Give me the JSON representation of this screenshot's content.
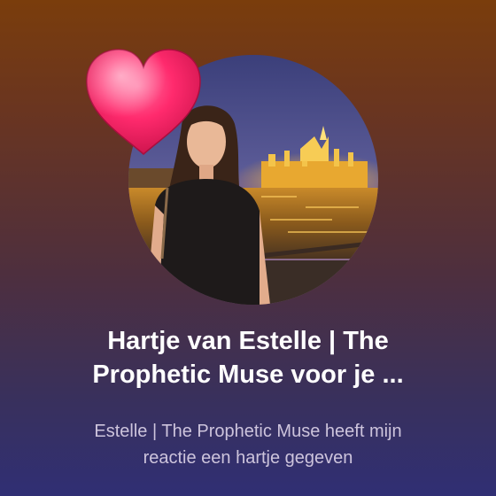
{
  "notification": {
    "title": "Hartje van Estelle | The\nProphetic Muse  voor je ...",
    "body": "Estelle | The Prophetic Muse  heeft mijn\nreactie een hartje gegeven",
    "avatar_icon": "profile-photo",
    "reaction_icon": "heart-icon",
    "colors": {
      "heart": "#ff2a6d",
      "title": "#ffffff",
      "body": "#cdc4dc"
    }
  }
}
